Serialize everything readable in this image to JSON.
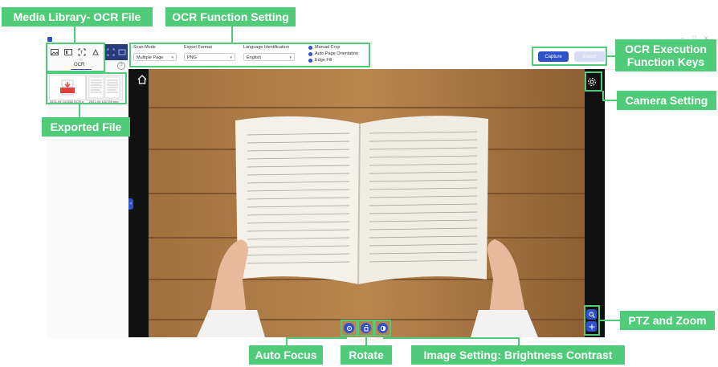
{
  "callouts": {
    "media_library": "Media Library- OCR File",
    "ocr_function_setting": "OCR Function Setting",
    "ocr_execution": "OCR Execution\nFunction Keys",
    "camera_setting": "Camera Setting",
    "exported_file": "Exported File",
    "ptz_zoom": "PTZ and Zoom",
    "auto_focus": "Auto Focus",
    "rotate": "Rotate",
    "image_setting": "Image Setting: Brightness Contrast"
  },
  "app": {
    "tab_label": "OCR",
    "help_glyph": "?",
    "thumbnails": [
      {
        "caption": "2021-04 141352 OCR.p"
      },
      {
        "caption": "2021-04 141726.png"
      }
    ]
  },
  "settings": {
    "scan_mode_label": "Scan Mode",
    "scan_mode_value": "Multiple Page",
    "export_format_label": "Export Format",
    "export_format_value": "PNG",
    "language_label": "Language Identification",
    "language_value": "English",
    "options": [
      "Manual Crop",
      "Auto Page Orientation",
      "Edge Fill"
    ]
  },
  "actions": {
    "capture": "Capture",
    "export": "Export"
  },
  "colors": {
    "callout_green": "#4fcb7a",
    "accent_blue": "#2f52c9"
  },
  "icons": {
    "home": "home-icon",
    "camera_settings": "gear-icon",
    "zoom": "zoom-icon",
    "ptz": "ptz-icon",
    "focus": "focus-icon",
    "rotate": "rotate-icon",
    "image": "image-adjust-icon"
  }
}
